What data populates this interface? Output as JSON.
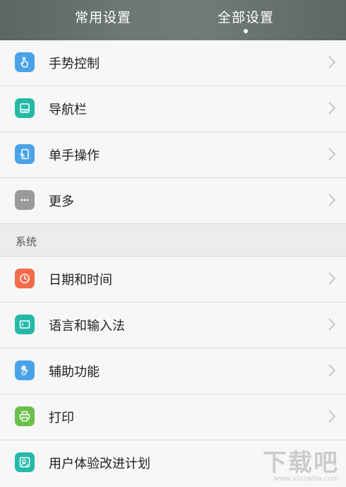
{
  "tabs": {
    "common": "常用设置",
    "all": "全部设置"
  },
  "rows_top": [
    {
      "label": "手势控制",
      "icon": "gesture-hand-icon",
      "color": "#4aa3e8"
    },
    {
      "label": "导航栏",
      "icon": "navigation-bar-icon",
      "color": "#26b9a8"
    },
    {
      "label": "单手操作",
      "icon": "one-hand-icon",
      "color": "#4aa3e8"
    },
    {
      "label": "更多",
      "icon": "more-dots-icon",
      "color": "#9a9a9a"
    }
  ],
  "section": {
    "label": "系统"
  },
  "rows_system": [
    {
      "label": "日期和时间",
      "icon": "clock-icon",
      "color": "#f26b4a"
    },
    {
      "label": "语言和输入法",
      "icon": "keyboard-icon",
      "color": "#26b9a8"
    },
    {
      "label": "辅助功能",
      "icon": "accessibility-hand-icon",
      "color": "#4aa3e8"
    },
    {
      "label": "打印",
      "icon": "printer-icon",
      "color": "#6cc04a"
    },
    {
      "label": "用户体验改进计划",
      "icon": "user-experience-icon",
      "color": "#26b9a8"
    }
  ],
  "watermark": {
    "logo": "下载吧",
    "url": "www.xiazaiba.com"
  }
}
